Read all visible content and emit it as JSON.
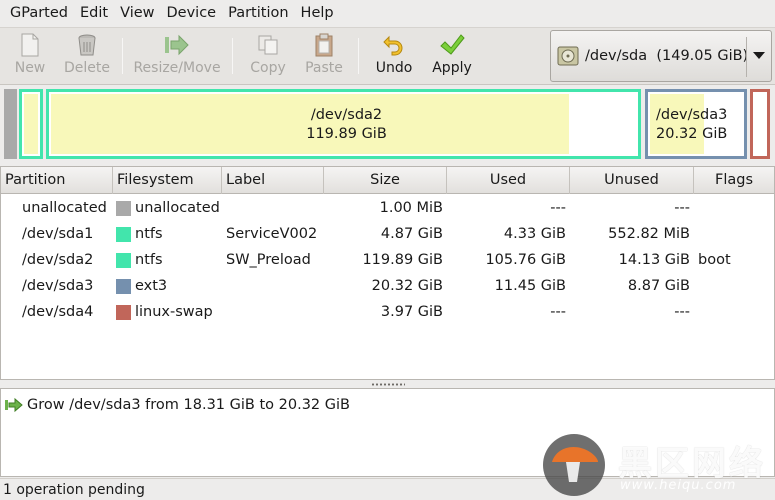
{
  "menubar": {
    "items": [
      {
        "label": "GParted"
      },
      {
        "label": "Edit"
      },
      {
        "label": "View"
      },
      {
        "label": "Device"
      },
      {
        "label": "Partition"
      },
      {
        "label": "Help"
      }
    ]
  },
  "toolbar": {
    "new_label": "New",
    "delete_label": "Delete",
    "resize_label": "Resize/Move",
    "copy_label": "Copy",
    "paste_label": "Paste",
    "undo_label": "Undo",
    "apply_label": "Apply",
    "device_select": "/dev/sda  (149.05 GiB)"
  },
  "colors": {
    "unallocated": "#a9a9a9",
    "ntfs": "#42e5ac",
    "ext3": "#7590ae",
    "linux_swap": "#c1665a",
    "used_fill": "#f8f8ba"
  },
  "map": {
    "sda2": {
      "name": "/dev/sda2",
      "size": "119.89 GiB",
      "used_fraction": 0.88
    },
    "sda3": {
      "name": "/dev/sda3",
      "size": "20.32 GiB",
      "used_fraction": 0.56
    }
  },
  "table": {
    "headers": [
      "Partition",
      "Filesystem",
      "Label",
      "Size",
      "Used",
      "Unused",
      "Flags"
    ],
    "rows": [
      {
        "partition": "unallocated",
        "filesystem": "unallocated",
        "fs_color": "#a9a9a9",
        "label": "",
        "size": "1.00 MiB",
        "used": "---",
        "unused": "---",
        "flags": ""
      },
      {
        "partition": "/dev/sda1",
        "filesystem": "ntfs",
        "fs_color": "#42e5ac",
        "label": "ServiceV002",
        "size": "4.87 GiB",
        "used": "4.33 GiB",
        "unused": "552.82 MiB",
        "flags": ""
      },
      {
        "partition": "/dev/sda2",
        "filesystem": "ntfs",
        "fs_color": "#42e5ac",
        "label": "SW_Preload",
        "size": "119.89 GiB",
        "used": "105.76 GiB",
        "unused": "14.13 GiB",
        "flags": "boot"
      },
      {
        "partition": "/dev/sda3",
        "filesystem": "ext3",
        "fs_color": "#7590ae",
        "label": "",
        "size": "20.32 GiB",
        "used": "11.45 GiB",
        "unused": "8.87 GiB",
        "flags": ""
      },
      {
        "partition": "/dev/sda4",
        "filesystem": "linux-swap",
        "fs_color": "#c1665a",
        "label": "",
        "size": "3.97 GiB",
        "used": "---",
        "unused": "---",
        "flags": ""
      }
    ]
  },
  "operations": [
    {
      "text": "Grow /dev/sda3 from 18.31 GiB to 20.32 GiB"
    }
  ],
  "status": "1 operation pending",
  "watermark": {
    "cn": "黑区网络",
    "url": "www.heiqu.com"
  }
}
